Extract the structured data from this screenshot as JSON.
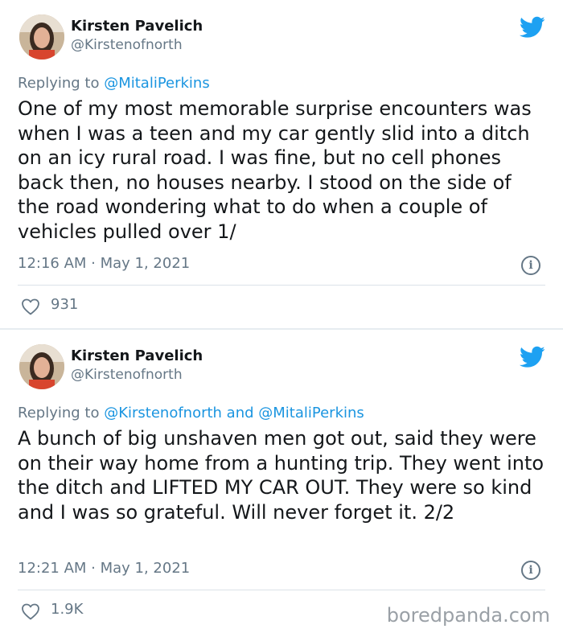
{
  "tweets": [
    {
      "author_name": "Kirsten Pavelich",
      "author_handle": "@Kirstenofnorth",
      "replying_prefix": "Replying to ",
      "replying_to": "@MitaliPerkins",
      "text": "One of my most memorable surprise encounters was when I was a teen and my car gently slid into a ditch on an icy rural road. I was fine, but no cell phones back then, no houses nearby. I stood on the side of the road wondering what to do when a couple of vehicles pulled over 1/",
      "timestamp": "12:16 AM · May 1, 2021",
      "likes": "931"
    },
    {
      "author_name": "Kirsten Pavelich",
      "author_handle": "@Kirstenofnorth",
      "replying_prefix": "Replying to ",
      "replying_to": "@Kirstenofnorth and @MitaliPerkins",
      "text": "A bunch of big unshaven men got out, said they were on their way home from a hunting trip. They went into the ditch and LIFTED MY CAR OUT. They were so kind and I was so grateful. Will never forget it. 2/2",
      "timestamp": "12:21 AM · May 1, 2021",
      "likes": "1.9K"
    }
  ],
  "icons": {
    "brand": "twitter-bird-icon",
    "info": "info-icon",
    "like": "heart-icon"
  },
  "info_glyph": "i",
  "watermark": "boredpanda.com",
  "colors": {
    "twitter_blue": "#1da1f2",
    "mention_blue": "#1b95e0",
    "text": "#14171a",
    "secondary": "#657786",
    "separator": "#e6ecf0"
  }
}
